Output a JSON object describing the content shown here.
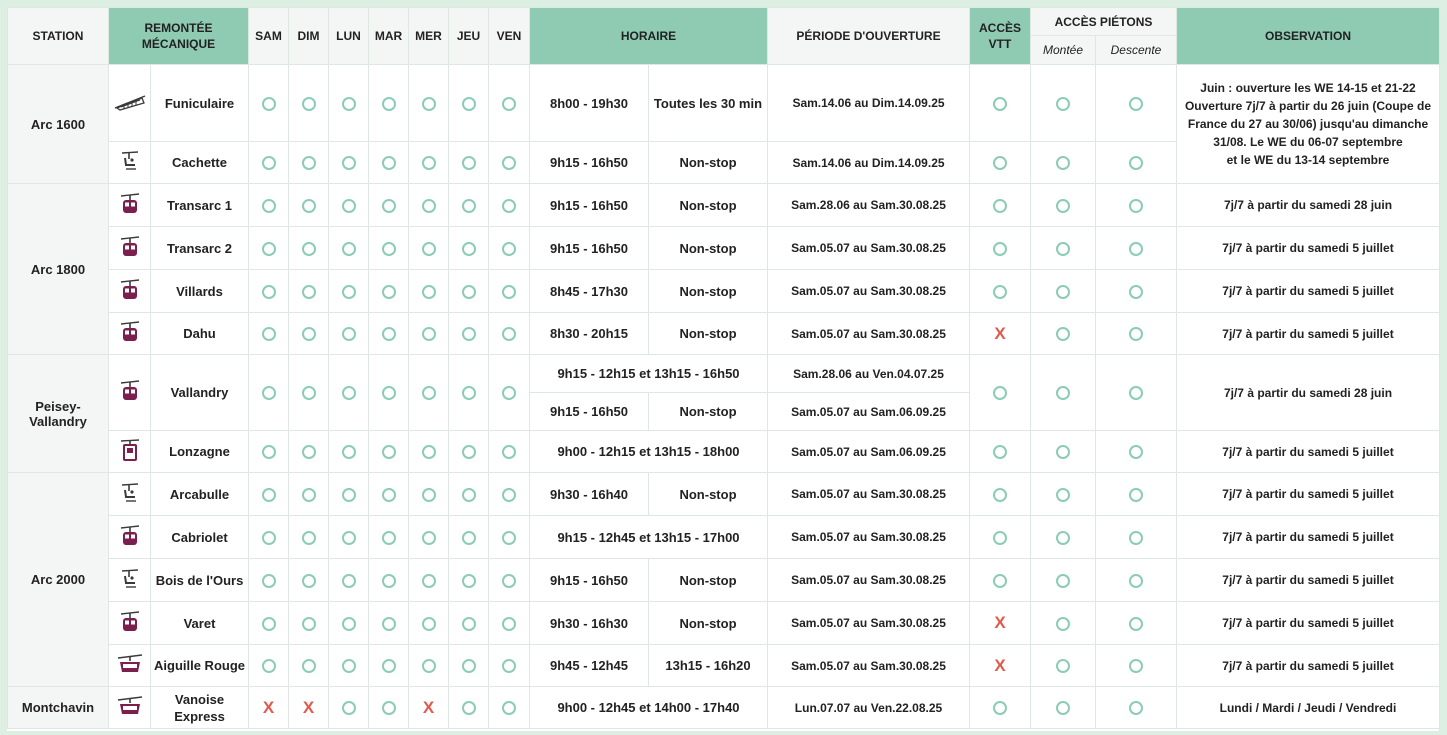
{
  "colors": {
    "header_accent": "#8fcbb3",
    "header_light": "#f4f6f5",
    "open_circle": "#8cccb5",
    "closed_x": "#e05a4c",
    "border": "#dde8e2"
  },
  "header": {
    "station": "STATION",
    "lift": "REMONTÉE MÉCANIQUE",
    "days": [
      "SAM",
      "DIM",
      "LUN",
      "MAR",
      "MER",
      "JEU",
      "VEN"
    ],
    "schedule": "HORAIRE",
    "period": "PÉRIODE D'OUVERTURE",
    "vtt": "ACCÈS VTT",
    "pedestrian": "ACCÈS PIÉTONS",
    "up": "Montée",
    "down": "Descente",
    "observation": "OBSERVATION"
  },
  "legend": {
    "open": "open-circle-icon",
    "closed": "X"
  },
  "stations": [
    {
      "name": "Arc 1600",
      "lifts": [
        {
          "icon": "funicular-icon",
          "name": "Funiculaire",
          "days": [
            "o",
            "o",
            "o",
            "o",
            "o",
            "o",
            "o"
          ],
          "hours": "8h00 - 19h30",
          "freq": "Toutes les 30 min",
          "period": "Sam.14.06 au Dim.14.09.25",
          "vtt": "o",
          "up": "o",
          "down": "o"
        },
        {
          "icon": "chairlift-icon",
          "name": "Cachette",
          "days": [
            "o",
            "o",
            "o",
            "o",
            "o",
            "o",
            "o"
          ],
          "hours": "9h15 - 16h50",
          "freq": "Non-stop",
          "period": "Sam.14.06 au Dim.14.09.25",
          "vtt": "o",
          "up": "o",
          "down": "o"
        }
      ],
      "observation": [
        "Juin : ouverture les WE 14-15 et 21-22",
        "Ouverture 7j/7 à partir du 26 juin (Coupe de France du 27 au 30/06) jusqu'au dimanche 31/08. Le WE du 06-07 septembre",
        "et le WE du 13-14 septembre"
      ]
    },
    {
      "name": "Arc 1800",
      "lifts": [
        {
          "icon": "gondola-icon",
          "name": "Transarc 1",
          "days": [
            "o",
            "o",
            "o",
            "o",
            "o",
            "o",
            "o"
          ],
          "hours": "9h15 - 16h50",
          "freq": "Non-stop",
          "period": "Sam.28.06 au Sam.30.08.25",
          "vtt": "o",
          "up": "o",
          "down": "o",
          "observation": "7j/7 à partir du samedi 28 juin"
        },
        {
          "icon": "gondola-icon",
          "name": "Transarc 2",
          "days": [
            "o",
            "o",
            "o",
            "o",
            "o",
            "o",
            "o"
          ],
          "hours": "9h15 - 16h50",
          "freq": "Non-stop",
          "period": "Sam.05.07 au Sam.30.08.25",
          "vtt": "o",
          "up": "o",
          "down": "o",
          "observation": "7j/7 à partir du samedi 5 juillet"
        },
        {
          "icon": "gondola-icon",
          "name": "Villards",
          "days": [
            "o",
            "o",
            "o",
            "o",
            "o",
            "o",
            "o"
          ],
          "hours": "8h45 - 17h30",
          "freq": "Non-stop",
          "period": "Sam.05.07 au Sam.30.08.25",
          "vtt": "o",
          "up": "o",
          "down": "o",
          "observation": "7j/7 à partir du samedi 5 juillet"
        },
        {
          "icon": "gondola-icon",
          "name": "Dahu",
          "days": [
            "o",
            "o",
            "o",
            "o",
            "o",
            "o",
            "o"
          ],
          "hours": "8h30 - 20h15",
          "freq": "Non-stop",
          "period": "Sam.05.07 au Sam.30.08.25",
          "vtt": "X",
          "up": "o",
          "down": "o",
          "observation": "7j/7 à partir du samedi 5 juillet"
        }
      ]
    },
    {
      "name": "Peisey-Vallandry",
      "name_lines": [
        "Peisey-",
        "Vallandry"
      ],
      "vallandry": {
        "icon": "gondola-icon",
        "name": "Vallandry",
        "days": [
          "o",
          "o",
          "o",
          "o",
          "o",
          "o",
          "o"
        ],
        "hours_a": "9h15 - 12h15 et 13h15 - 16h50",
        "period_a": "Sam.28.06 au Ven.04.07.25",
        "hours_b": "9h15 - 16h50",
        "freq_b": "Non-stop",
        "period_b": "Sam.05.07 au Sam.06.09.25",
        "vtt": "o",
        "up": "o",
        "down": "o",
        "observation": "7j/7 à partir du samedi 28 juin"
      },
      "lonzagne": {
        "icon": "cable-car-icon",
        "name": "Lonzagne",
        "days": [
          "o",
          "o",
          "o",
          "o",
          "o",
          "o",
          "o"
        ],
        "hours": "9h00 - 12h15 et 13h15 - 18h00",
        "period": "Sam.05.07 au Sam.06.09.25",
        "vtt": "o",
        "up": "o",
        "down": "o",
        "observation": "7j/7 à partir du samedi 5 juillet"
      }
    },
    {
      "name": "Arc 2000",
      "lifts": [
        {
          "icon": "chairlift-icon",
          "name": "Arcabulle",
          "days": [
            "o",
            "o",
            "o",
            "o",
            "o",
            "o",
            "o"
          ],
          "hours": "9h30 - 16h40",
          "freq": "Non-stop",
          "period": "Sam.05.07 au Sam.30.08.25",
          "vtt": "o",
          "up": "o",
          "down": "o",
          "observation": "7j/7 à partir du samedi 5 juillet"
        },
        {
          "icon": "gondola-icon",
          "name": "Cabriolet",
          "days": [
            "o",
            "o",
            "o",
            "o",
            "o",
            "o",
            "o"
          ],
          "hours_full": "9h15 - 12h45 et 13h15 - 17h00",
          "period": "Sam.05.07 au Sam.30.08.25",
          "vtt": "o",
          "up": "o",
          "down": "o",
          "observation": "7j/7 à partir du samedi 5 juillet"
        },
        {
          "icon": "chairlift-icon",
          "name": "Bois de l'Ours",
          "days": [
            "o",
            "o",
            "o",
            "o",
            "o",
            "o",
            "o"
          ],
          "hours": "9h15 - 16h50",
          "freq": "Non-stop",
          "period": "Sam.05.07 au Sam.30.08.25",
          "vtt": "o",
          "up": "o",
          "down": "o",
          "observation": "7j/7 à partir du samedi 5 juillet"
        },
        {
          "icon": "gondola-icon",
          "name": "Varet",
          "days": [
            "o",
            "o",
            "o",
            "o",
            "o",
            "o",
            "o"
          ],
          "hours": "9h30 - 16h30",
          "freq": "Non-stop",
          "period": "Sam.05.07 au Sam.30.08.25",
          "vtt": "X",
          "up": "o",
          "down": "o",
          "observation": "7j/7 à partir du samedi 5 juillet"
        },
        {
          "icon": "aerial-tram-icon",
          "name": "Aiguille Rouge",
          "days": [
            "o",
            "o",
            "o",
            "o",
            "o",
            "o",
            "o"
          ],
          "hours": "9h45 - 12h45",
          "freq": "13h15 - 16h20",
          "period": "Sam.05.07 au Sam.30.08.25",
          "vtt": "X",
          "up": "o",
          "down": "o",
          "observation": "7j/7 à partir du samedi 5 juillet"
        }
      ]
    },
    {
      "name": "Montchavin",
      "lifts": [
        {
          "icon": "aerial-tram-icon",
          "name": "Vanoise Express",
          "name_lines": [
            "Vanoise",
            "Express"
          ],
          "days": [
            "X",
            "X",
            "o",
            "o",
            "X",
            "o",
            "o"
          ],
          "hours_full": "9h00 - 12h45 et 14h00 - 17h40",
          "period": "Lun.07.07 au Ven.22.08.25",
          "vtt": "o",
          "up": "o",
          "down": "o",
          "observation": "Lundi / Mardi / Jeudi / Vendredi"
        }
      ]
    }
  ]
}
